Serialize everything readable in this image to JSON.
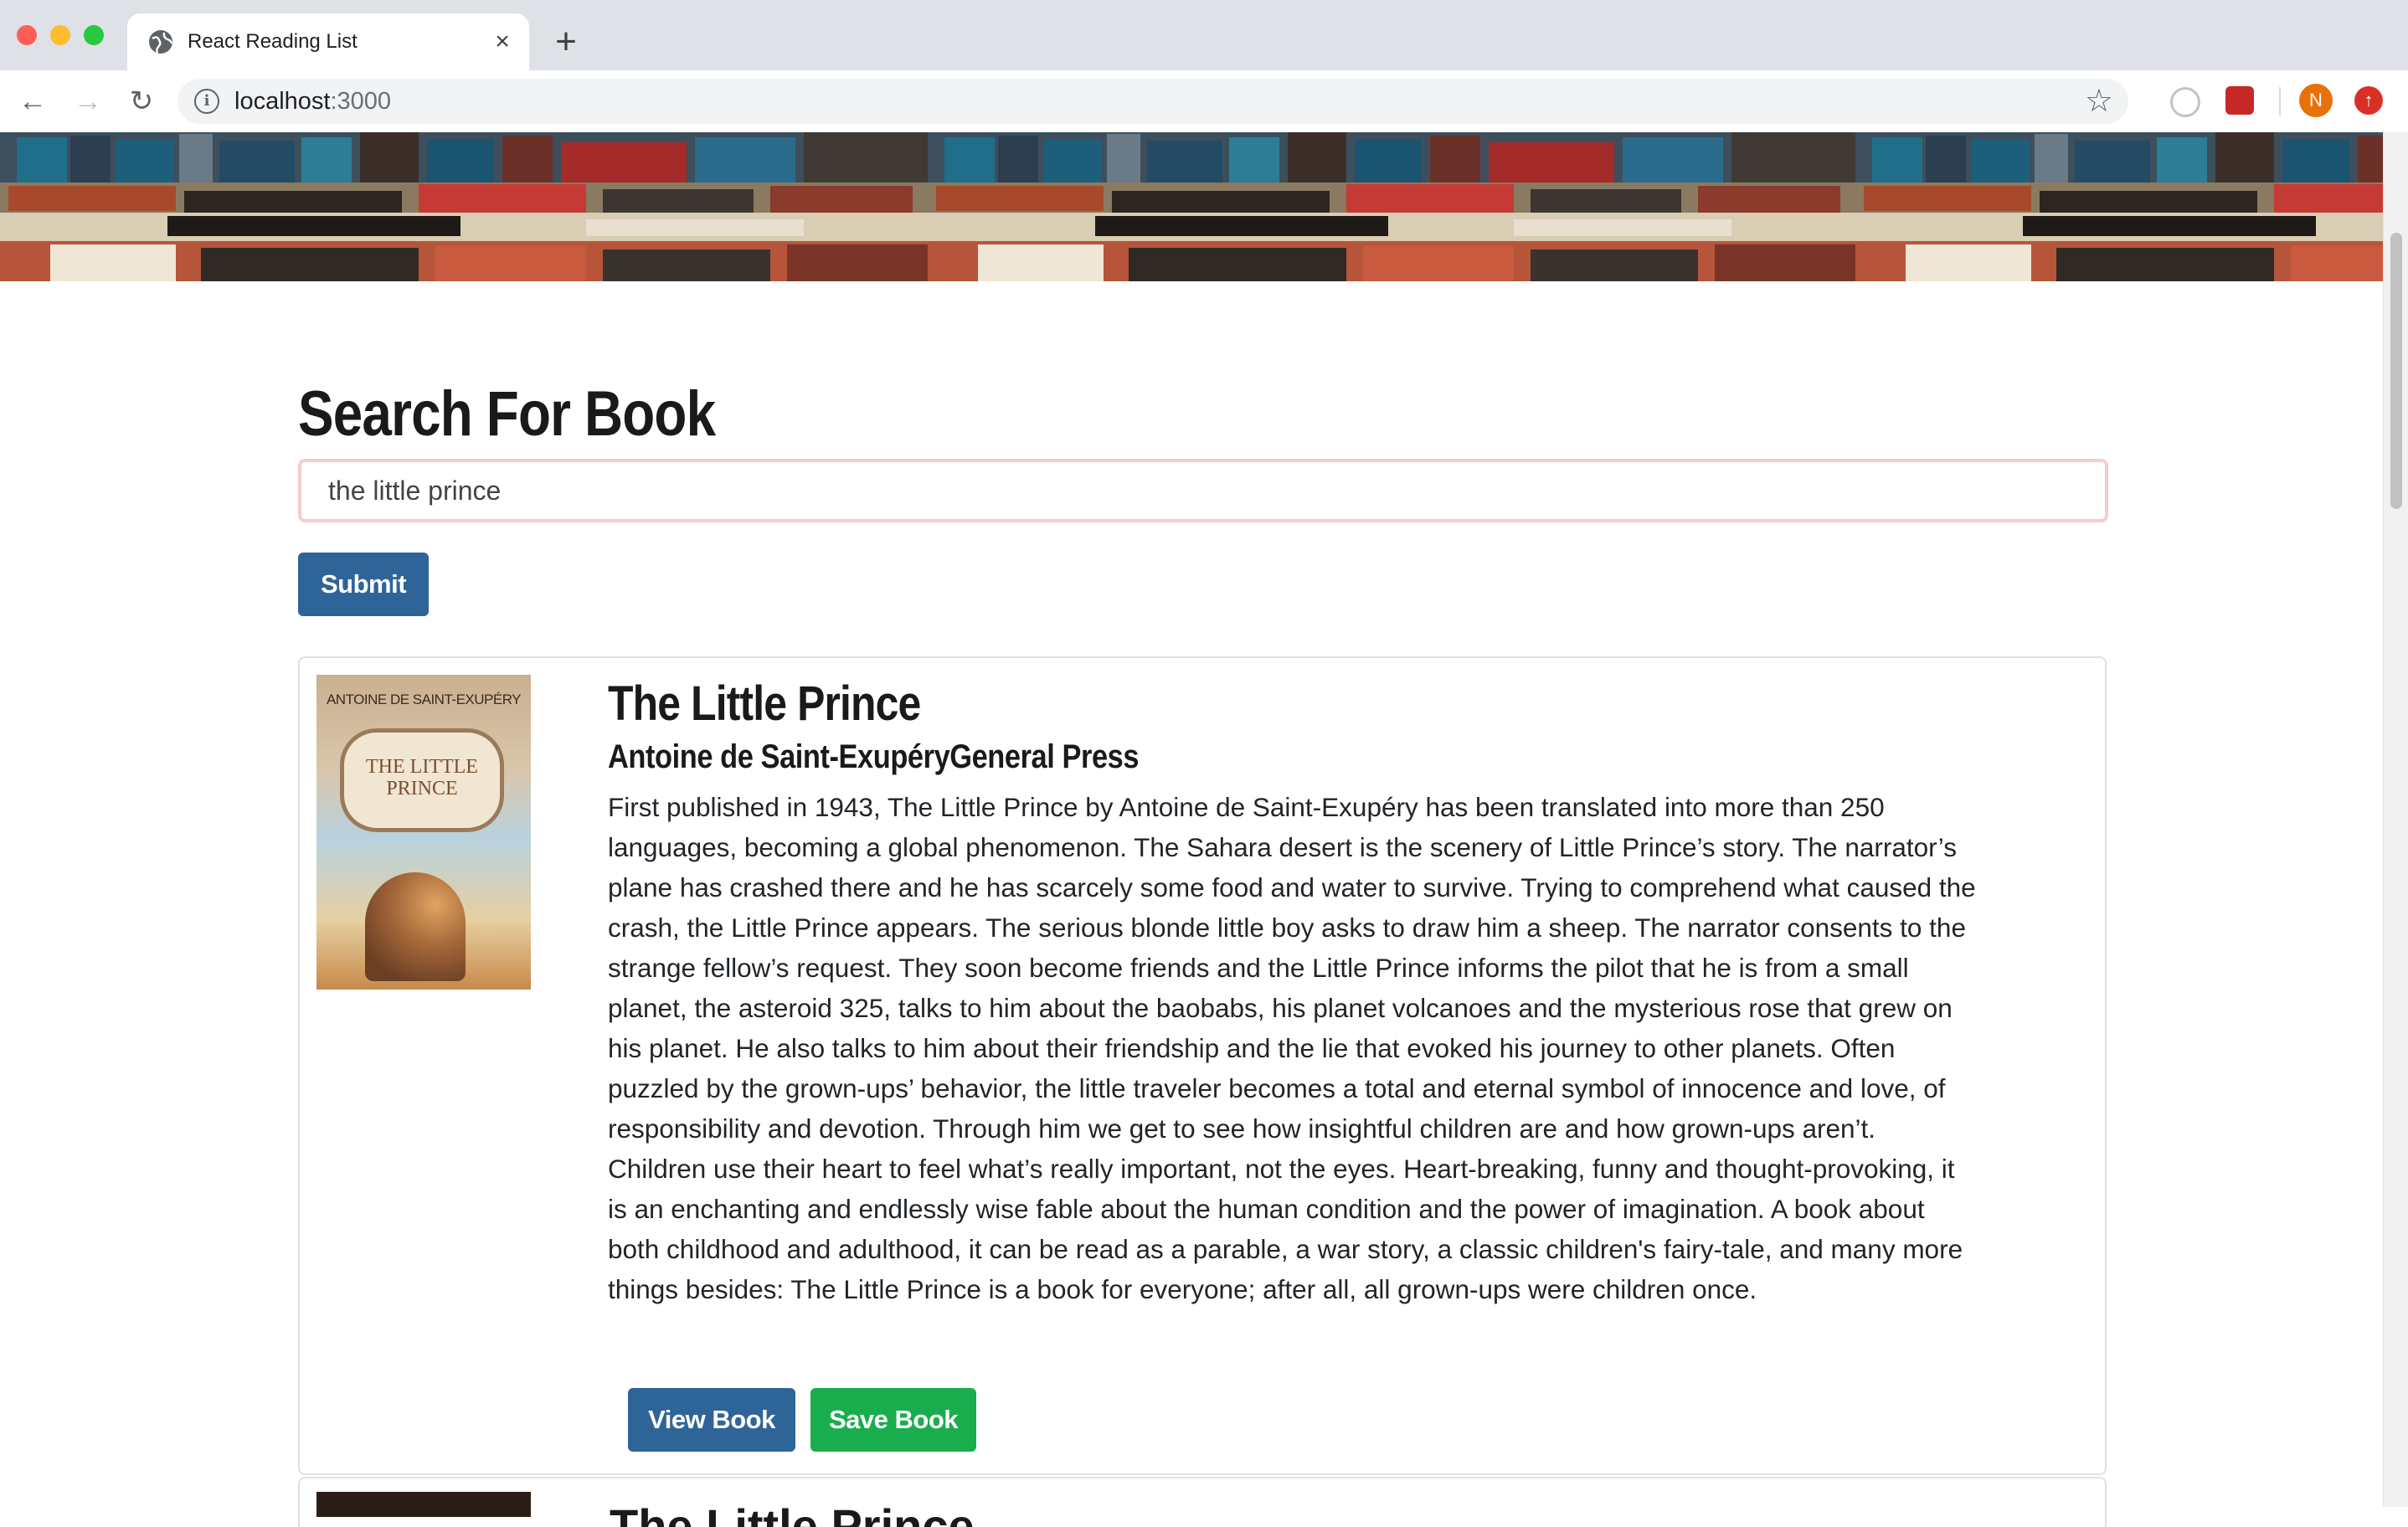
{
  "browser": {
    "tab_title": "React Reading List",
    "tab_close": "×",
    "new_tab": "+",
    "url_host": "localhost",
    "url_port": ":3000",
    "profile_initial": "N"
  },
  "page": {
    "title": "Search For Book",
    "search": {
      "value": "the little prince",
      "placeholder": ""
    },
    "submit_label": "Submit"
  },
  "results": [
    {
      "title": "The Little Prince",
      "authors": "Antoine de Saint-ExupéryGeneral Press",
      "cover": {
        "author": "ANTOINE DE SAINT-EXUPÉRY",
        "title": "THE LITTLE PRINCE"
      },
      "description": "First published in 1943, The Little Prince by Antoine de Saint-Exupéry has been translated into more than 250 languages, becoming a global phenomenon. The Sahara desert is the scenery of Little Prince’s story. The narrator’s plane has crashed there and he has scarcely some food and water to survive. Trying to comprehend what caused the crash, the Little Prince appears. The serious blonde little boy asks to draw him a sheep. The narrator consents to the strange fellow’s request. They soon become friends and the Little Prince informs the pilot that he is from a small planet, the asteroid 325, talks to him about the baobabs, his planet volcanoes and the mysterious rose that grew on his planet. He also talks to him about their friendship and the lie that evoked his journey to other planets. Often puzzled by the grown-ups’ behavior, the little traveler becomes a total and eternal symbol of innocence and love, of responsibility and devotion. Through him we get to see how insightful children are and how grown-ups aren’t. Children use their heart to feel what’s really important, not the eyes. Heart-breaking, funny and thought-provoking, it is an enchanting and endlessly wise fable about the human condition and the power of imagination. A book about both childhood and adulthood, it can be read as a parable, a war story, a classic children's fairy-tale, and many more things besides: The Little Prince is a book for everyone; after all, all grown-ups were children once.",
      "view_label": "View Book",
      "save_label": "Save Book"
    },
    {
      "title": "The Little Prince"
    }
  ],
  "colors": {
    "primary_button": "#2f6499",
    "success_button": "#19ad4e",
    "input_border": "#f6cccc"
  },
  "icons": [
    "globe-icon",
    "close-icon",
    "plus-icon",
    "back-arrow-icon",
    "forward-arrow-icon",
    "reload-icon",
    "info-icon",
    "star-icon",
    "extension-icon",
    "profile-avatar",
    "update-icon"
  ]
}
